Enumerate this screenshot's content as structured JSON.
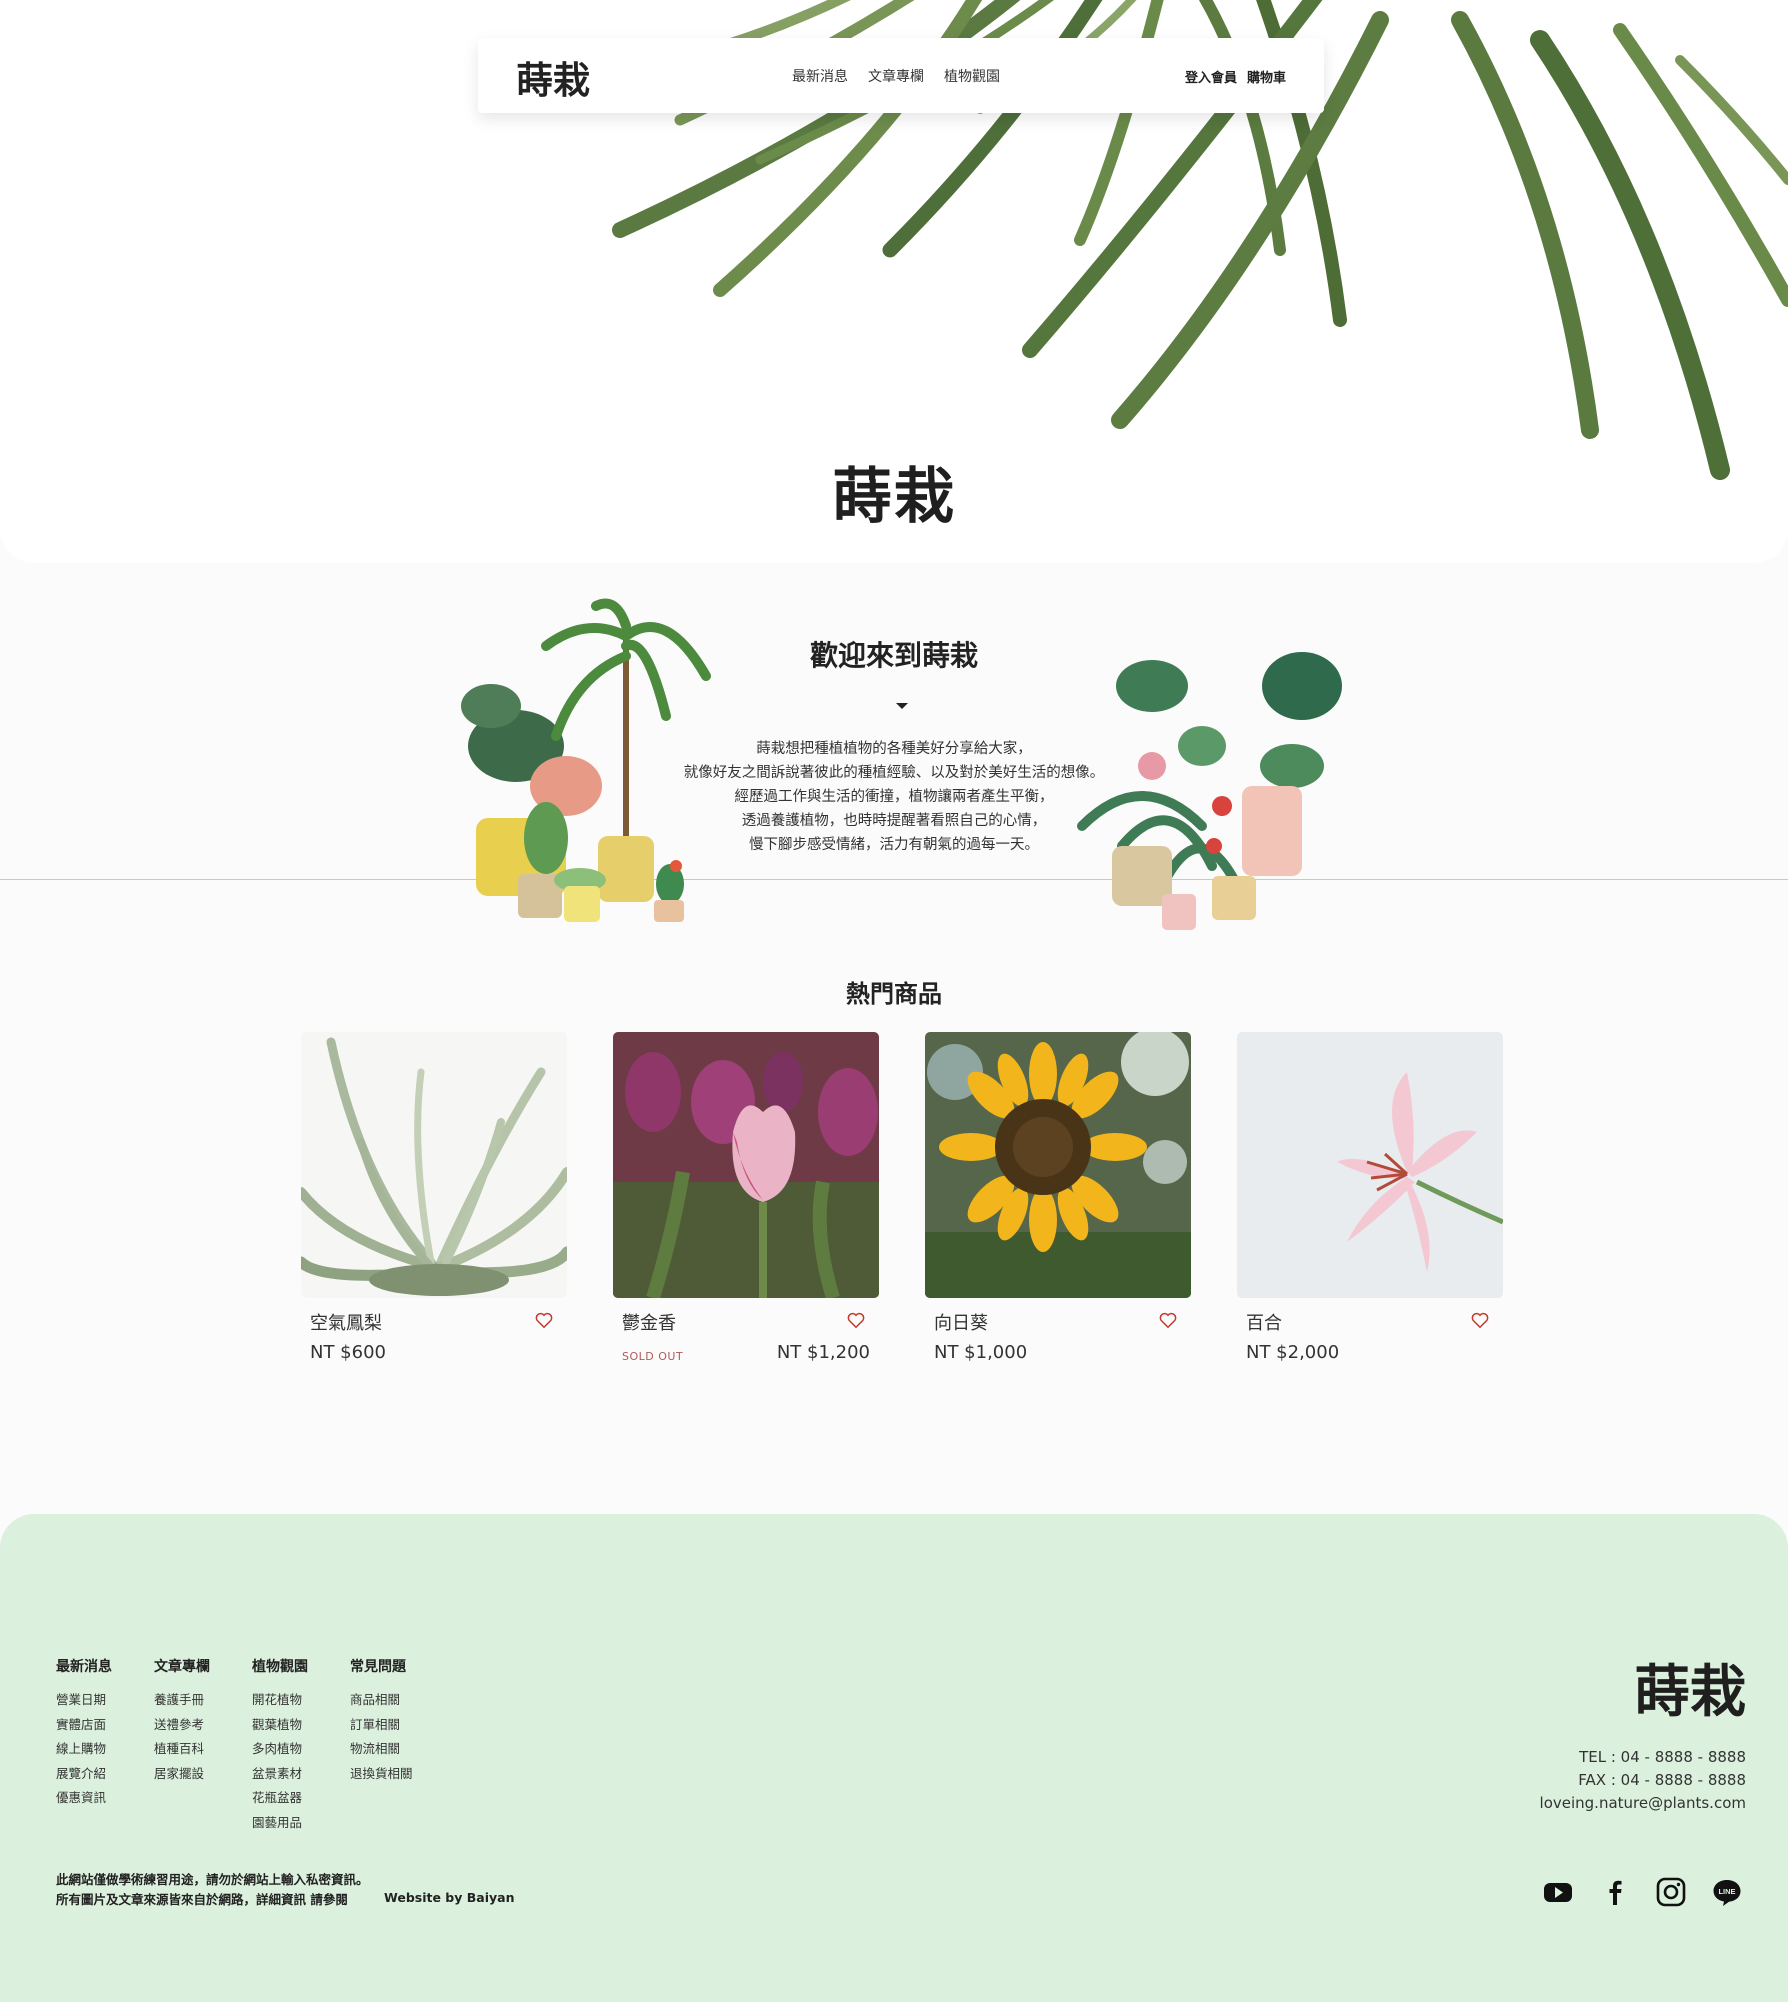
{
  "site": {
    "logo": "蒔栽",
    "hero_title": "蒔栽"
  },
  "nav": {
    "center": [
      "最新消息",
      "文章專欄",
      "植物觀園"
    ],
    "right": [
      "登入會員",
      "購物車"
    ]
  },
  "welcome": {
    "title": "歡迎來到蒔栽",
    "lines": [
      "蒔栽想把種植植物的各種美好分享給大家，",
      "就像好友之間訴說著彼此的種植經驗、以及對於美好生活的想像。",
      "經歷過工作與生活的衝撞，植物讓兩者產生平衡，",
      "透過養護植物，也時時提醒著看照自己的心情，",
      "慢下腳步感受情緒，活力有朝氣的過每一天。"
    ]
  },
  "products": {
    "title": "熱門商品",
    "items": [
      {
        "name": "空氣鳳梨",
        "price": "NT $600",
        "status": ""
      },
      {
        "name": "鬱金香",
        "price": "NT $1,200",
        "status": "SOLD OUT"
      },
      {
        "name": "向日葵",
        "price": "NT $1,000",
        "status": ""
      },
      {
        "name": "百合",
        "price": "NT $2,000",
        "status": ""
      }
    ]
  },
  "footer": {
    "columns": [
      {
        "title": "最新消息",
        "items": [
          "營業日期",
          "實體店面",
          "線上購物",
          "展覽介紹",
          "優惠資訊"
        ]
      },
      {
        "title": "文章專欄",
        "items": [
          "養護手冊",
          "送禮參考",
          "植種百科",
          "居家擺設"
        ]
      },
      {
        "title": "植物觀園",
        "items": [
          "開花植物",
          "觀葉植物",
          "多肉植物",
          "盆景素材",
          "花瓶盆器",
          "園藝用品"
        ]
      },
      {
        "title": "常見問題",
        "items": [
          "商品相關",
          "訂單相關",
          "物流相關",
          "退換貨相關"
        ]
      }
    ],
    "logo": "蒔栽",
    "tel": "TEL : 04 - 8888 - 8888",
    "fax": "FAX : 04 - 8888 - 8888",
    "email": "loveing.nature@plants.com",
    "note_line1": "此網站僅做學術練習用途，請勿於網站上輸入私密資訊。",
    "note_line2": "所有圖片及文章來源皆來自於網路，詳細資訊 請參閱",
    "credit": "Website by Baiyan",
    "social_icons": [
      "youtube-icon",
      "facebook-icon",
      "instagram-icon",
      "line-icon"
    ]
  }
}
